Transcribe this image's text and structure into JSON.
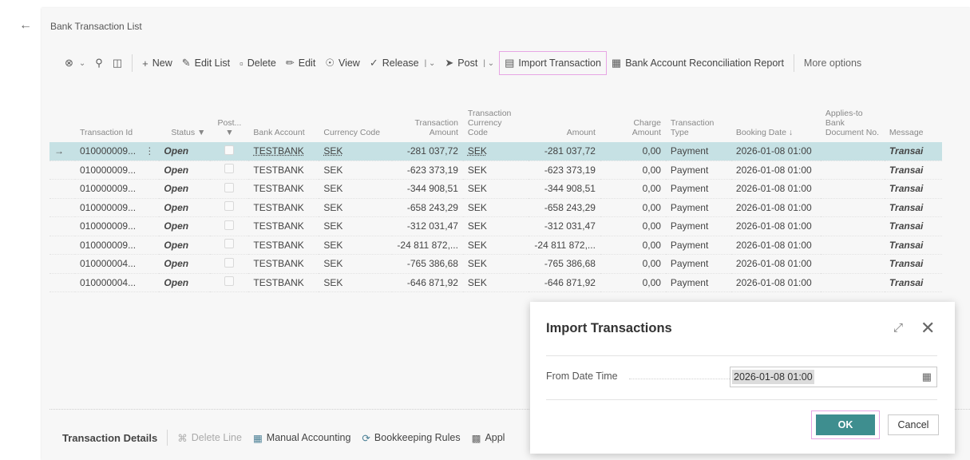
{
  "header": {
    "back_icon": "arrow-left-icon",
    "title": "Bank Transaction List"
  },
  "action_bar": {
    "items": [
      {
        "label": "New",
        "icon": "plus-icon"
      },
      {
        "label": "Edit List",
        "icon": "edit-list-icon"
      },
      {
        "label": "Delete",
        "icon": "trash-icon"
      },
      {
        "label": "Edit",
        "icon": "pencil-icon"
      },
      {
        "label": "View",
        "icon": "eye-icon"
      },
      {
        "label": "Release",
        "icon": "release-icon"
      },
      {
        "label": "Post",
        "icon": "post-icon"
      },
      {
        "label": "Import Transaction",
        "icon": "import-icon"
      },
      {
        "label": "Bank Account Reconciliation Report",
        "icon": "report-icon"
      },
      {
        "label": "More options",
        "icon": ""
      }
    ]
  },
  "table": {
    "columns": [
      "Transaction Id",
      "Status",
      "Post...",
      "Bank Account",
      "Currency Code",
      "Transaction Amount",
      "Transaction Currency Code",
      "Amount",
      "Charge Amount",
      "Transaction Type",
      "Booking Date",
      "Applies-to Bank Document No.",
      "Message"
    ],
    "rows": [
      {
        "id": "010000009...",
        "status": "Open",
        "bank": "TESTBANK",
        "currency": "SEK",
        "tx_amount": "-281 037,72",
        "tx_currency": "SEK",
        "amount": "-281 037,72",
        "charge": "0,00",
        "type": "Payment",
        "booking": "2026-01-08 01:00",
        "applies": "",
        "message": "Transai"
      },
      {
        "id": "010000009...",
        "status": "Open",
        "bank": "TESTBANK",
        "currency": "SEK",
        "tx_amount": "-623 373,19",
        "tx_currency": "SEK",
        "amount": "-623 373,19",
        "charge": "0,00",
        "type": "Payment",
        "booking": "2026-01-08 01:00",
        "applies": "",
        "message": "Transai"
      },
      {
        "id": "010000009...",
        "status": "Open",
        "bank": "TESTBANK",
        "currency": "SEK",
        "tx_amount": "-344 908,51",
        "tx_currency": "SEK",
        "amount": "-344 908,51",
        "charge": "0,00",
        "type": "Payment",
        "booking": "2026-01-08 01:00",
        "applies": "",
        "message": "Transai"
      },
      {
        "id": "010000009...",
        "status": "Open",
        "bank": "TESTBANK",
        "currency": "SEK",
        "tx_amount": "-658 243,29",
        "tx_currency": "SEK",
        "amount": "-658 243,29",
        "charge": "0,00",
        "type": "Payment",
        "booking": "2026-01-08 01:00",
        "applies": "",
        "message": "Transai"
      },
      {
        "id": "010000009...",
        "status": "Open",
        "bank": "TESTBANK",
        "currency": "SEK",
        "tx_amount": "-312 031,47",
        "tx_currency": "SEK",
        "amount": "-312 031,47",
        "charge": "0,00",
        "type": "Payment",
        "booking": "2026-01-08 01:00",
        "applies": "",
        "message": "Transai"
      },
      {
        "id": "010000009...",
        "status": "Open",
        "bank": "TESTBANK",
        "currency": "SEK",
        "tx_amount": "-24 811 872,...",
        "tx_currency": "SEK",
        "amount": "-24 811 872,...",
        "charge": "0,00",
        "type": "Payment",
        "booking": "2026-01-08 01:00",
        "applies": "",
        "message": "Transai"
      },
      {
        "id": "010000004...",
        "status": "Open",
        "bank": "TESTBANK",
        "currency": "SEK",
        "tx_amount": "-765 386,68",
        "tx_currency": "SEK",
        "amount": "-765 386,68",
        "charge": "0,00",
        "type": "Payment",
        "booking": "2026-01-08 01:00",
        "applies": "",
        "message": "Transai"
      },
      {
        "id": "010000004...",
        "status": "Open",
        "bank": "TESTBANK",
        "currency": "SEK",
        "tx_amount": "-646 871,92",
        "tx_currency": "SEK",
        "amount": "-646 871,92",
        "charge": "0,00",
        "type": "Payment",
        "booking": "2026-01-08 01:00",
        "applies": "",
        "message": "Transai"
      }
    ]
  },
  "details_bar": {
    "title": "Transaction Details",
    "items": [
      {
        "label": "Delete Line",
        "icon": "delete-line-icon"
      },
      {
        "label": "Manual Accounting",
        "icon": "accounting-icon"
      },
      {
        "label": "Bookkeeping Rules",
        "icon": "rules-icon"
      },
      {
        "label": "Appl",
        "icon": "apply-icon"
      }
    ]
  },
  "dialog": {
    "title": "Import Transactions",
    "field_label": "From Date Time",
    "field_value": "2026-01-08 01:00",
    "ok_label": "OK",
    "cancel_label": "Cancel"
  },
  "colors": {
    "accent": "#3e8e8f",
    "status_open": "#b02b2b",
    "selected_row": "#c6e1e4",
    "highlight": "#e7a6e4"
  }
}
